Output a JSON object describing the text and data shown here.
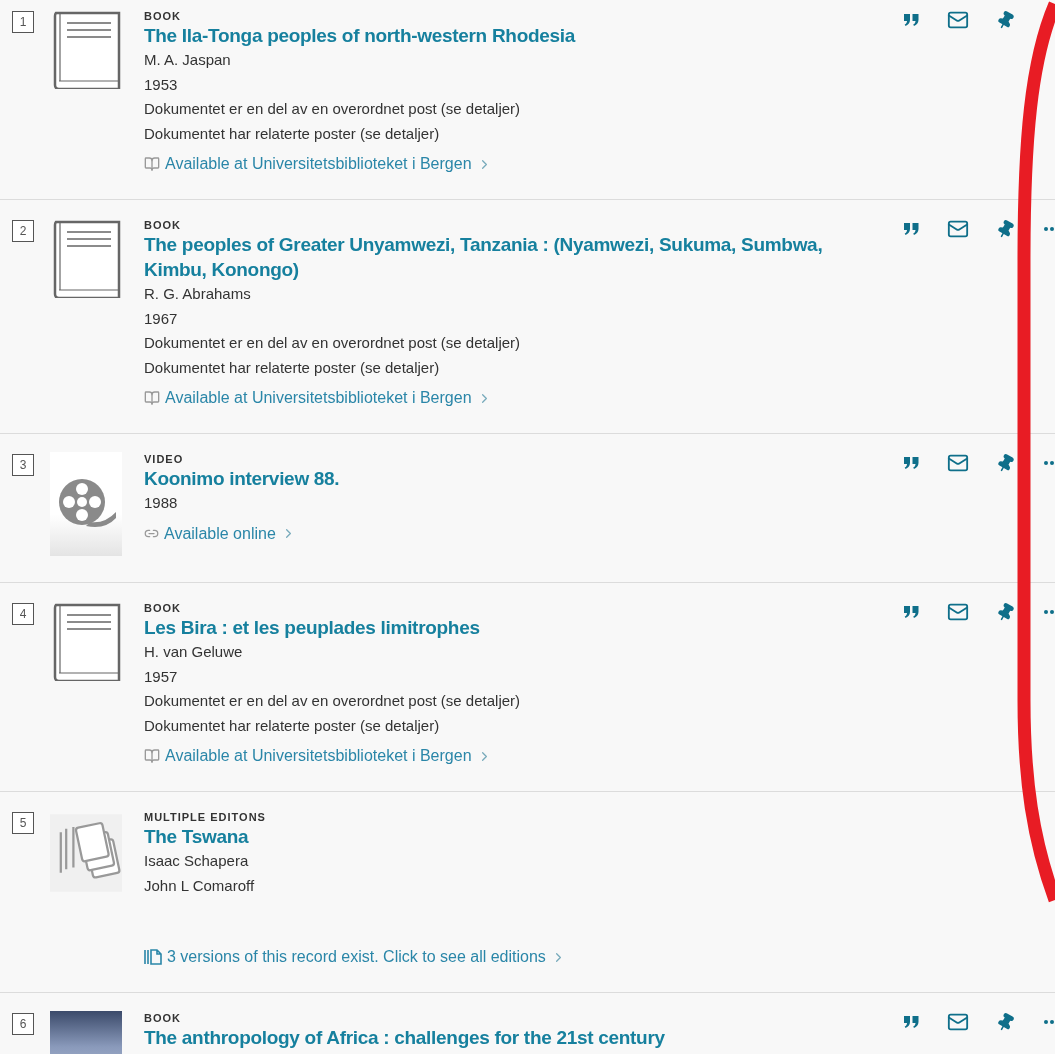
{
  "results": [
    {
      "number": "1",
      "kind": "book",
      "type": "BOOK",
      "title": "The Ila-Tonga peoples of north-western Rhodesia",
      "lines": [
        "M. A. Jaspan",
        "1953",
        "Dokumentet er en del av en overordnet post (se detaljer)",
        "Dokumentet har relaterte poster (se detaljer)"
      ],
      "availability": {
        "kind": "physical",
        "text": "Available at Universitetsbiblioteket i Bergen"
      },
      "actions": [
        {
          "kind": "cite"
        },
        {
          "kind": "email"
        },
        {
          "kind": "pin"
        }
      ]
    },
    {
      "number": "2",
      "kind": "book",
      "type": "BOOK",
      "title": "The peoples of Greater Unyamwezi, Tanzania : (Nyamwezi, Sukuma, Sumbwa, Kimbu, Konongo)",
      "lines": [
        "R. G. Abrahams",
        "1967",
        "Dokumentet er en del av en overordnet post (se detaljer)",
        "Dokumentet har relaterte poster (se detaljer)"
      ],
      "availability": {
        "kind": "physical",
        "text": "Available at Universitetsbiblioteket i Bergen"
      },
      "actions": [
        {
          "kind": "cite"
        },
        {
          "kind": "email"
        },
        {
          "kind": "pin"
        },
        {
          "kind": "more"
        }
      ]
    },
    {
      "number": "3",
      "kind": "video",
      "type": "VIDEO",
      "title": "Koonimo interview 88.",
      "lines": [
        "1988"
      ],
      "availability": {
        "kind": "online",
        "text": "Available online"
      },
      "actions": [
        {
          "kind": "cite"
        },
        {
          "kind": "email"
        },
        {
          "kind": "pin"
        },
        {
          "kind": "more"
        }
      ]
    },
    {
      "number": "4",
      "kind": "book",
      "type": "BOOK",
      "title": "Les Bira : et les peuplades limitrophes",
      "lines": [
        "H. van Geluwe",
        "1957",
        "Dokumentet er en del av en overordnet post (se detaljer)",
        "Dokumentet har relaterte poster (se detaljer)"
      ],
      "availability": {
        "kind": "physical",
        "text": "Available at Universitetsbiblioteket i Bergen"
      },
      "actions": [
        {
          "kind": "cite"
        },
        {
          "kind": "email"
        },
        {
          "kind": "pin"
        },
        {
          "kind": "more"
        }
      ]
    },
    {
      "number": "5",
      "kind": "editions",
      "type": "MULTIPLE EDITONS",
      "title": "The Tswana",
      "lines": [
        "Isaac Schapera",
        "John L Comaroff"
      ],
      "availability": {
        "kind": "editions",
        "text": "3 versions of this record exist. Click to see all editions"
      }
    },
    {
      "number": "6",
      "kind": "cover",
      "type": "BOOK",
      "title": "The anthropology of Africa : challenges for the 21st century",
      "actions": [
        {
          "kind": "cite"
        },
        {
          "kind": "email"
        },
        {
          "kind": "pin"
        },
        {
          "kind": "more"
        }
      ]
    }
  ]
}
